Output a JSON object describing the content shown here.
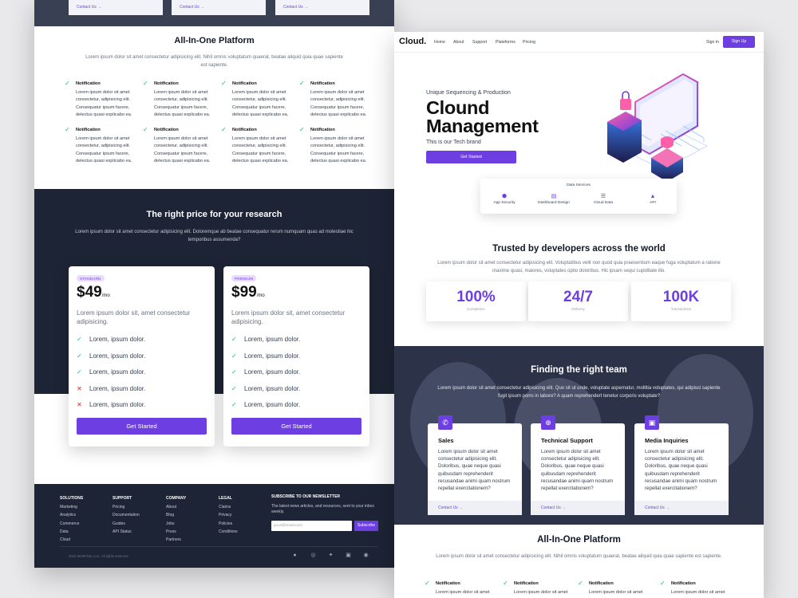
{
  "left_page": {
    "top_cards": [
      "Contact Us",
      "Contact Us",
      "Contact Us"
    ],
    "platform": {
      "title": "All-In-One Platform",
      "description": "Lorem ipsum dolor sit amet consectetur adipisicing elit. Nihil omnis voluptatum quaerat, beatae aliquid quia quae sapiente est sapiente.",
      "features": [
        {
          "title": "Notification",
          "text": "Lorem ipsum dolor sit amet consectetur, adipisicing elit. Consequatur ipsum facere, delectus quasi explicabo ea."
        },
        {
          "title": "Notification",
          "text": "Lorem ipsum dolor sit amet consectetur, adipisicing elit. Consequatur ipsum facere, delectus quasi explicabo ea."
        },
        {
          "title": "Notification",
          "text": "Lorem ipsum dolor sit amet consectetur, adipisicing elit. Consequatur ipsum facere, delectus quasi explicabo ea."
        },
        {
          "title": "Notification",
          "text": "Lorem ipsum dolor sit amet consectetur, adipisicing elit. Consequatur ipsum facere, delectus quasi explicabo ea."
        },
        {
          "title": "Notification",
          "text": "Lorem ipsum dolor sit amet consectetur, adipisicing elit. Consequatur ipsum facere, delectus quasi explicabo ea."
        },
        {
          "title": "Notification",
          "text": "Lorem ipsum dolor sit amet consectetur, adipisicing elit. Consequatur ipsum facere, delectus quasi explicabo ea."
        },
        {
          "title": "Notification",
          "text": "Lorem ipsum dolor sit amet consectetur, adipisicing elit. Consequatur ipsum facere, delectus quasi explicabo ea."
        },
        {
          "title": "Notification",
          "text": "Lorem ipsum dolor sit amet consectetur, adipisicing elit. Consequatur ipsum facere, delectus quasi explicabo ea."
        }
      ]
    },
    "pricing": {
      "title": "The right price for your research",
      "description": "Lorem ipsum dolor sit amet consectetur adipisicing elit. Doloremque ab beatae consequatur rerum numquam quas ad molestiae hic temporibus assumenda?",
      "plans": [
        {
          "badge": "STANDARD",
          "price": "$49",
          "period": "/mo",
          "description": "Lorem ipsum dolor sit, amet consectetur adipisicing.",
          "button": "Get Started",
          "items": [
            {
              "text": "Lorem, ipsum dolor.",
              "ok": true
            },
            {
              "text": "Lorem, ipsum dolor.",
              "ok": true
            },
            {
              "text": "Lorem, ipsum dolor.",
              "ok": true
            },
            {
              "text": "Lorem, ipsum dolor.",
              "ok": false
            },
            {
              "text": "Lorem, ipsum dolor.",
              "ok": false
            }
          ]
        },
        {
          "badge": "PREMIUM",
          "price": "$99",
          "period": "/mo",
          "description": "Lorem ipsum dolor sit, amet consectetur adipisicing.",
          "button": "Get Started",
          "items": [
            {
              "text": "Lorem, ipsum dolor.",
              "ok": true
            },
            {
              "text": "Lorem, ipsum dolor.",
              "ok": true
            },
            {
              "text": "Lorem, ipsum dolor.",
              "ok": true
            },
            {
              "text": "Lorem, ipsum dolor.",
              "ok": true
            },
            {
              "text": "Lorem, ipsum dolor.",
              "ok": true
            }
          ]
        }
      ]
    },
    "footer": {
      "columns": [
        {
          "heading": "SOLUTIONS",
          "links": [
            "Marketing",
            "Analytics",
            "Commerce",
            "Data",
            "Cloud"
          ]
        },
        {
          "heading": "SUPPORT",
          "links": [
            "Pricing",
            "Documentation",
            "Guides",
            "API Status"
          ]
        },
        {
          "heading": "COMPANY",
          "links": [
            "About",
            "Blog",
            "Jobs",
            "Press",
            "Partners"
          ]
        },
        {
          "heading": "LEGAL",
          "links": [
            "Claims",
            "Privacy",
            "Policies",
            "Conditions"
          ]
        }
      ],
      "newsletter": {
        "heading": "SUBSCRIBE TO OUR NEWSLETTER",
        "text": "The latest news articles, and resources, sent to your inbox weekly.",
        "placeholder": "your@email.com",
        "button": "Subscribe"
      },
      "copyright": "2022 WorkFlow, LLC. All rights reserved.",
      "social_icons": [
        "facebook-icon",
        "instagram-icon",
        "twitter-icon",
        "twitch-icon",
        "github-icon"
      ]
    }
  },
  "right_page": {
    "nav": {
      "logo": "Cloud.",
      "links": [
        "Home",
        "About",
        "Support",
        "Plateforms",
        "Pricing"
      ],
      "sign_in": "Sign In",
      "sign_up": "Sign Up"
    },
    "hero": {
      "subtitle": "Unique Sequencing & Production",
      "title_line1": "Clound",
      "title_line2": "Management",
      "tagline": "This is our Tech brand",
      "button": "Get Started"
    },
    "services": {
      "title": "Data Services",
      "items": [
        {
          "label": "App Security",
          "icon": "shield-icon"
        },
        {
          "label": "Dashboard Design",
          "icon": "database-icon"
        },
        {
          "label": "Cloud Data",
          "icon": "server-icon"
        },
        {
          "label": "API",
          "icon": "api-icon"
        }
      ]
    },
    "trusted": {
      "title": "Trusted by developers across the world",
      "description": "Lorem ipsum dolor sit amet consectetur adipisicing elit. Voluptatibus velit non quod quia praesentium eaque fuga voluptatum a ratione maxime quasi, maiores, voluptates optio doloribus. Hic ipsam sequi cupiditate illo.",
      "stats": [
        {
          "value": "100%",
          "label": "Completion"
        },
        {
          "value": "24/7",
          "label": "Delivery"
        },
        {
          "value": "100K",
          "label": "Transactions"
        }
      ]
    },
    "team": {
      "title": "Finding the right team",
      "description": "Lorem ipsum dolor sit amet consectetur adipisicing elit. Quo sit ut unde, voluptate aspernatur, mollitia voluptates, qui adipisci sapiente fugit ipsum porro in labore? A quam reprehendert tenetur corporis voluptate?",
      "cards": [
        {
          "title": "Sales",
          "icon": "phone-icon",
          "text": "Lorem ipsum dolor sit amet consectetur adipisicing elit. Doloribus, quae neque quasi quibusdam reprehenderit recusandae animi quam nostrum repellat exercitationem?",
          "link": "Contact Us"
        },
        {
          "title": "Technical Support",
          "icon": "globe-icon",
          "text": "Lorem ipsum dolor sit amet consectetur adipisicing elit. Doloribus, quae neque quasi quibusdam reprehenderit recusandae animi quam nostrum repellat exercitationem?",
          "link": "Contact Us"
        },
        {
          "title": "Media Inquiries",
          "icon": "chip-icon",
          "text": "Lorem ipsum dolor sit amet consectetur adipisicing elit. Doloribus, quae neque quasi quibusdam reprehenderit recusandae animi quam nostrum repellat exercitationem?",
          "link": "Contact Us"
        }
      ]
    },
    "platform": {
      "title": "All-In-One Platform",
      "description": "Lorem ipsum dolor sit amet consectetur adipisicing elit. Nihil omnis voluptatum quaerat, beatae aliquid quia quae sapiente est sapiente.",
      "features": [
        {
          "title": "Notification",
          "text": "Lorem ipsum dolor sit amet"
        },
        {
          "title": "Notification",
          "text": "Lorem ipsum dolor sit amet"
        },
        {
          "title": "Notification",
          "text": "Lorem ipsum dolor sit amet"
        },
        {
          "title": "Notification",
          "text": "Lorem ipsum dolor sit amet"
        }
      ]
    }
  },
  "colors": {
    "accent": "#6d3fe2",
    "dark": "#1d2435",
    "check": "#10b981",
    "cross": "#dc2626"
  }
}
